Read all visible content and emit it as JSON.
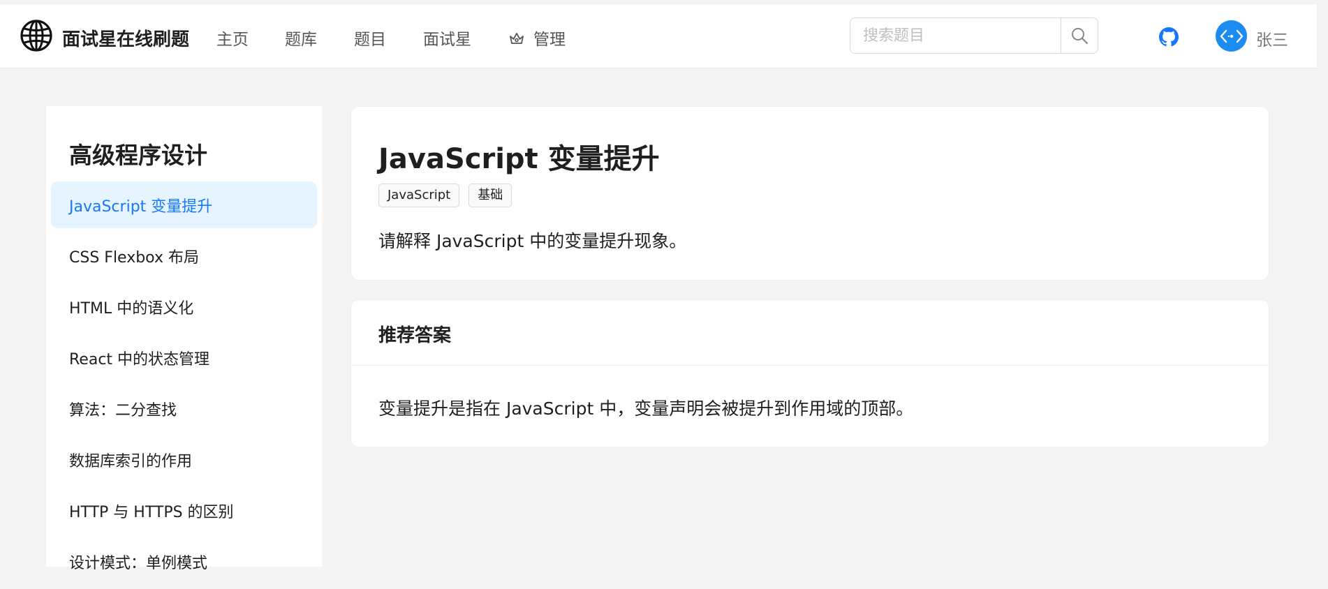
{
  "header": {
    "site_title": "面试星在线刷题",
    "nav": [
      "主页",
      "题库",
      "题目",
      "面试星"
    ],
    "admin_label": "管理",
    "search_placeholder": "搜索题目",
    "username": "张三",
    "icons": {
      "logo": "globe-icon",
      "admin": "crown-icon",
      "search": "search-icon",
      "github": "github-icon",
      "avatar": "code-avatar-icon"
    }
  },
  "sidebar": {
    "title": "高级程序设计",
    "items": [
      "JavaScript 变量提升",
      "CSS Flexbox 布局",
      "HTML 中的语义化",
      "React 中的状态管理",
      "算法：二分查找",
      "数据库索引的作用",
      "HTTP 与 HTTPS 的区别",
      "设计模式：单例模式"
    ],
    "active_index": 0
  },
  "question": {
    "title": "JavaScript 变量提升",
    "tags": [
      "JavaScript",
      "基础"
    ],
    "description": "请解释 JavaScript 中的变量提升现象。"
  },
  "answer": {
    "heading": "推荐答案",
    "content": "变量提升是指在 JavaScript 中，变量声明会被提升到作用域的顶部。"
  },
  "colors": {
    "accent": "#1677ff",
    "active_bg": "#e6f4ff",
    "avatar_bg": "#1c8cf0",
    "page_bg": "#f4f4f4"
  }
}
